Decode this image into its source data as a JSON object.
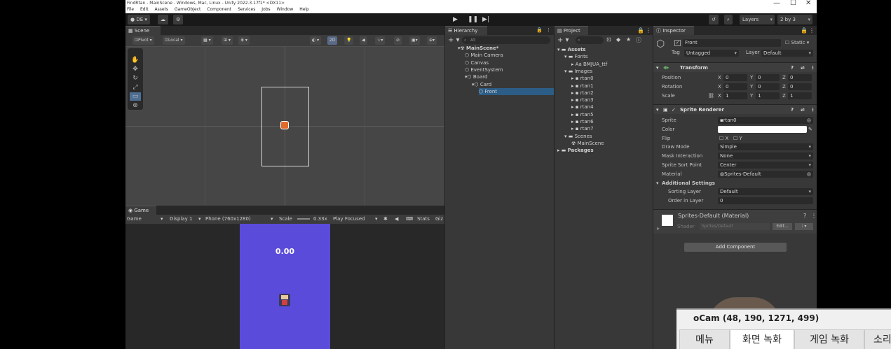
{
  "window": {
    "title": "FindRtan - MainScene - Windows, Mac, Linux - Unity 2022.3.17f1* <DX11>"
  },
  "menu": [
    "File",
    "Edit",
    "Assets",
    "GameObject",
    "Component",
    "Services",
    "Jobs",
    "Window",
    "Help"
  ],
  "toolbar": {
    "account": "DE",
    "layers": "Layers",
    "layout": "2 by 3"
  },
  "scene": {
    "tab": "Scene",
    "pivot": "Pivot",
    "local": "Local",
    "mode_2d": "2D"
  },
  "game": {
    "tab": "Game",
    "view": "Game",
    "display": "Display 1",
    "resolution": "Phone (760x1280)",
    "scale_label": "Scale",
    "scale_value": "0.33x",
    "play_focused": "Play Focused",
    "stats": "Stats",
    "gizmos": "Giz",
    "timer": "0.00"
  },
  "hierarchy": {
    "tab": "Hierarchy",
    "search_placeholder": "All",
    "items": [
      {
        "label": "MainScene*",
        "depth": 0
      },
      {
        "label": "Main Camera",
        "depth": 1
      },
      {
        "label": "Canvas",
        "depth": 1
      },
      {
        "label": "EventSystem",
        "depth": 1
      },
      {
        "label": "Board",
        "depth": 1
      },
      {
        "label": "Card",
        "depth": 2
      },
      {
        "label": "Front",
        "depth": 3
      }
    ]
  },
  "project": {
    "tab": "Project",
    "items": [
      {
        "label": "Assets",
        "depth": 0
      },
      {
        "label": "Fonts",
        "depth": 1
      },
      {
        "label": "BMJUA_ttf",
        "depth": 2
      },
      {
        "label": "Images",
        "depth": 1
      },
      {
        "label": "rtan0",
        "depth": 2
      },
      {
        "label": "rtan1",
        "depth": 2
      },
      {
        "label": "rtan2",
        "depth": 2
      },
      {
        "label": "rtan3",
        "depth": 2
      },
      {
        "label": "rtan4",
        "depth": 2
      },
      {
        "label": "rtan5",
        "depth": 2
      },
      {
        "label": "rtan6",
        "depth": 2
      },
      {
        "label": "rtan7",
        "depth": 2
      },
      {
        "label": "Scenes",
        "depth": 1
      },
      {
        "label": "MainScene",
        "depth": 2
      },
      {
        "label": "Packages",
        "depth": 0
      }
    ]
  },
  "inspector": {
    "tab": "Inspector",
    "object_name": "Front",
    "static": "Static",
    "tag_label": "Tag",
    "tag_value": "Untagged",
    "layer_label": "Layer",
    "layer_value": "Default",
    "transform": {
      "title": "Transform",
      "position_label": "Position",
      "rotation_label": "Rotation",
      "scale_label": "Scale",
      "position": [
        "0",
        "0",
        "0"
      ],
      "rotation": [
        "0",
        "0",
        "0"
      ],
      "scale": [
        "1",
        "1",
        "1"
      ],
      "axes": [
        "X",
        "Y",
        "Z"
      ]
    },
    "sprite_renderer": {
      "title": "Sprite Renderer",
      "sprite_label": "Sprite",
      "sprite_value": "rtan0",
      "color_label": "Color",
      "flip_label": "Flip",
      "flip_x": "X",
      "flip_y": "Y",
      "draw_mode_label": "Draw Mode",
      "draw_mode_value": "Simple",
      "mask_label": "Mask Interaction",
      "mask_value": "None",
      "sort_point_label": "Sprite Sort Point",
      "sort_point_value": "Center",
      "material_label": "Material",
      "material_value": "Sprites-Default",
      "additional": "Additional Settings",
      "sorting_layer_label": "Sorting Layer",
      "sorting_layer_value": "Default",
      "order_label": "Order in Layer",
      "order_value": "0"
    },
    "material": {
      "title": "Sprites-Default (Material)",
      "shader_label": "Shader",
      "shader_value": "Sprites/Default",
      "edit": "Edit..."
    },
    "add_component": "Add Component"
  },
  "ocam": {
    "title": "oCam (48, 190, 1271, 499)",
    "tabs": [
      "메뉴",
      "화면 녹화",
      "게임 녹화",
      "소리"
    ]
  },
  "colors": {
    "accent": "#2c5d87",
    "game_bg": "#5b4bdb"
  }
}
